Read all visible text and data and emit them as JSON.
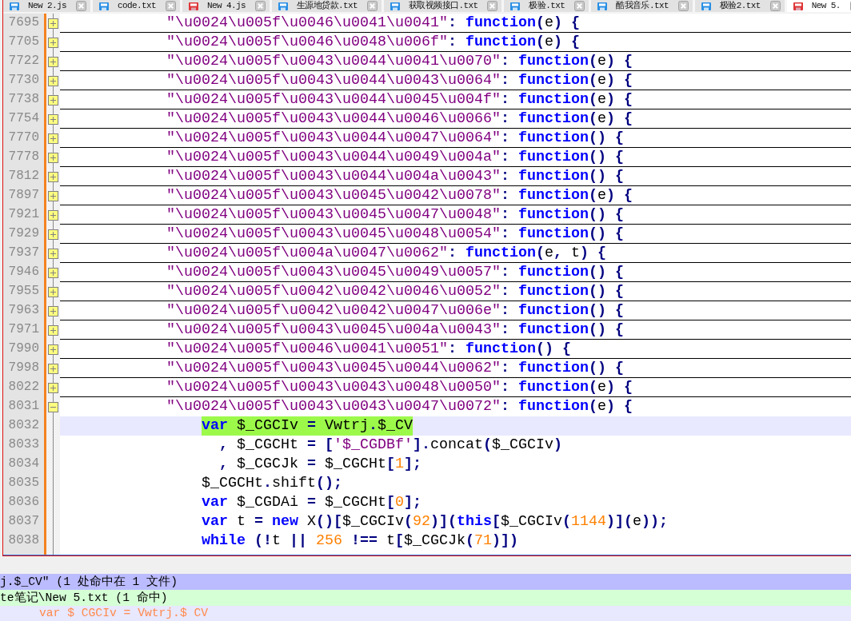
{
  "tabs": [
    {
      "label": "New 2.js",
      "modified": false,
      "selected": false
    },
    {
      "label": "code.txt",
      "modified": false,
      "selected": false
    },
    {
      "label": "New 4.js",
      "modified": true,
      "selected": false
    },
    {
      "label": "生源地贷款.txt",
      "modified": false,
      "selected": false
    },
    {
      "label": "获取视频接口.txt",
      "modified": false,
      "selected": false
    },
    {
      "label": "极验.txt",
      "modified": false,
      "selected": false
    },
    {
      "label": "酷我音乐.txt",
      "modified": false,
      "selected": false
    },
    {
      "label": "极验2.txt",
      "modified": false,
      "selected": false
    },
    {
      "label": "New 5.",
      "modified": true,
      "selected": true
    }
  ],
  "editor": {
    "lines": [
      {
        "number": "7695",
        "expanded": false,
        "current": false,
        "highlighted": false,
        "tokens": [
          {
            "kind": "str",
            "text": "\"\\u0024\\u005f\\u0046\\u0041\\u0041\""
          },
          {
            "kind": "op",
            "text": ": "
          },
          {
            "kind": "kw",
            "text": "function"
          },
          {
            "kind": "op",
            "text": "("
          },
          {
            "kind": "id",
            "text": "e"
          },
          {
            "kind": "op",
            "text": ") {"
          }
        ]
      },
      {
        "number": "7705",
        "expanded": false,
        "current": false,
        "highlighted": false,
        "tokens": [
          {
            "kind": "str",
            "text": "\"\\u0024\\u005f\\u0046\\u0048\\u006f\""
          },
          {
            "kind": "op",
            "text": ": "
          },
          {
            "kind": "kw",
            "text": "function"
          },
          {
            "kind": "op",
            "text": "("
          },
          {
            "kind": "id",
            "text": "e"
          },
          {
            "kind": "op",
            "text": ") {"
          }
        ]
      },
      {
        "number": "7722",
        "expanded": false,
        "current": false,
        "highlighted": false,
        "tokens": [
          {
            "kind": "str",
            "text": "\"\\u0024\\u005f\\u0043\\u0044\\u0041\\u0070\""
          },
          {
            "kind": "op",
            "text": ": "
          },
          {
            "kind": "kw",
            "text": "function"
          },
          {
            "kind": "op",
            "text": "("
          },
          {
            "kind": "id",
            "text": "e"
          },
          {
            "kind": "op",
            "text": ") {"
          }
        ]
      },
      {
        "number": "7730",
        "expanded": false,
        "current": false,
        "highlighted": false,
        "tokens": [
          {
            "kind": "str",
            "text": "\"\\u0024\\u005f\\u0043\\u0044\\u0043\\u0064\""
          },
          {
            "kind": "op",
            "text": ": "
          },
          {
            "kind": "kw",
            "text": "function"
          },
          {
            "kind": "op",
            "text": "("
          },
          {
            "kind": "id",
            "text": "e"
          },
          {
            "kind": "op",
            "text": ") {"
          }
        ]
      },
      {
        "number": "7738",
        "expanded": false,
        "current": false,
        "highlighted": false,
        "tokens": [
          {
            "kind": "str",
            "text": "\"\\u0024\\u005f\\u0043\\u0044\\u0045\\u004f\""
          },
          {
            "kind": "op",
            "text": ": "
          },
          {
            "kind": "kw",
            "text": "function"
          },
          {
            "kind": "op",
            "text": "("
          },
          {
            "kind": "id",
            "text": "e"
          },
          {
            "kind": "op",
            "text": ") {"
          }
        ]
      },
      {
        "number": "7754",
        "expanded": false,
        "current": false,
        "highlighted": false,
        "tokens": [
          {
            "kind": "str",
            "text": "\"\\u0024\\u005f\\u0043\\u0044\\u0046\\u0066\""
          },
          {
            "kind": "op",
            "text": ": "
          },
          {
            "kind": "kw",
            "text": "function"
          },
          {
            "kind": "op",
            "text": "("
          },
          {
            "kind": "id",
            "text": "e"
          },
          {
            "kind": "op",
            "text": ") {"
          }
        ]
      },
      {
        "number": "7770",
        "expanded": false,
        "current": false,
        "highlighted": false,
        "tokens": [
          {
            "kind": "str",
            "text": "\"\\u0024\\u005f\\u0043\\u0044\\u0047\\u0064\""
          },
          {
            "kind": "op",
            "text": ": "
          },
          {
            "kind": "kw",
            "text": "function"
          },
          {
            "kind": "op",
            "text": "() {"
          }
        ]
      },
      {
        "number": "7778",
        "expanded": false,
        "current": false,
        "highlighted": false,
        "tokens": [
          {
            "kind": "str",
            "text": "\"\\u0024\\u005f\\u0043\\u0044\\u0049\\u004a\""
          },
          {
            "kind": "op",
            "text": ": "
          },
          {
            "kind": "kw",
            "text": "function"
          },
          {
            "kind": "op",
            "text": "() {"
          }
        ]
      },
      {
        "number": "7812",
        "expanded": false,
        "current": false,
        "highlighted": false,
        "tokens": [
          {
            "kind": "str",
            "text": "\"\\u0024\\u005f\\u0043\\u0044\\u004a\\u0043\""
          },
          {
            "kind": "op",
            "text": ": "
          },
          {
            "kind": "kw",
            "text": "function"
          },
          {
            "kind": "op",
            "text": "() {"
          }
        ]
      },
      {
        "number": "7897",
        "expanded": false,
        "current": false,
        "highlighted": false,
        "tokens": [
          {
            "kind": "str",
            "text": "\"\\u0024\\u005f\\u0043\\u0045\\u0042\\u0078\""
          },
          {
            "kind": "op",
            "text": ": "
          },
          {
            "kind": "kw",
            "text": "function"
          },
          {
            "kind": "op",
            "text": "("
          },
          {
            "kind": "id",
            "text": "e"
          },
          {
            "kind": "op",
            "text": ") {"
          }
        ]
      },
      {
        "number": "7921",
        "expanded": false,
        "current": false,
        "highlighted": false,
        "tokens": [
          {
            "kind": "str",
            "text": "\"\\u0024\\u005f\\u0043\\u0045\\u0047\\u0048\""
          },
          {
            "kind": "op",
            "text": ": "
          },
          {
            "kind": "kw",
            "text": "function"
          },
          {
            "kind": "op",
            "text": "() {"
          }
        ]
      },
      {
        "number": "7929",
        "expanded": false,
        "current": false,
        "highlighted": false,
        "tokens": [
          {
            "kind": "str",
            "text": "\"\\u0024\\u005f\\u0043\\u0045\\u0048\\u0054\""
          },
          {
            "kind": "op",
            "text": ": "
          },
          {
            "kind": "kw",
            "text": "function"
          },
          {
            "kind": "op",
            "text": "() {"
          }
        ]
      },
      {
        "number": "7937",
        "expanded": false,
        "current": false,
        "highlighted": false,
        "tokens": [
          {
            "kind": "str",
            "text": "\"\\u0024\\u005f\\u004a\\u0047\\u0062\""
          },
          {
            "kind": "op",
            "text": ": "
          },
          {
            "kind": "kw",
            "text": "function"
          },
          {
            "kind": "op",
            "text": "("
          },
          {
            "kind": "id",
            "text": "e"
          },
          {
            "kind": "op",
            "text": ", "
          },
          {
            "kind": "id",
            "text": "t"
          },
          {
            "kind": "op",
            "text": ") {"
          }
        ]
      },
      {
        "number": "7946",
        "expanded": false,
        "current": false,
        "highlighted": false,
        "tokens": [
          {
            "kind": "str",
            "text": "\"\\u0024\\u005f\\u0043\\u0045\\u0049\\u0057\""
          },
          {
            "kind": "op",
            "text": ": "
          },
          {
            "kind": "kw",
            "text": "function"
          },
          {
            "kind": "op",
            "text": "() {"
          }
        ]
      },
      {
        "number": "7955",
        "expanded": false,
        "current": false,
        "highlighted": false,
        "tokens": [
          {
            "kind": "str",
            "text": "\"\\u0024\\u005f\\u0042\\u0042\\u0046\\u0052\""
          },
          {
            "kind": "op",
            "text": ": "
          },
          {
            "kind": "kw",
            "text": "function"
          },
          {
            "kind": "op",
            "text": "() {"
          }
        ]
      },
      {
        "number": "7963",
        "expanded": false,
        "current": false,
        "highlighted": false,
        "tokens": [
          {
            "kind": "str",
            "text": "\"\\u0024\\u005f\\u0042\\u0042\\u0047\\u006e\""
          },
          {
            "kind": "op",
            "text": ": "
          },
          {
            "kind": "kw",
            "text": "function"
          },
          {
            "kind": "op",
            "text": "() {"
          }
        ]
      },
      {
        "number": "7971",
        "expanded": false,
        "current": false,
        "highlighted": false,
        "tokens": [
          {
            "kind": "str",
            "text": "\"\\u0024\\u005f\\u0043\\u0045\\u004a\\u0043\""
          },
          {
            "kind": "op",
            "text": ": "
          },
          {
            "kind": "kw",
            "text": "function"
          },
          {
            "kind": "op",
            "text": "() {"
          }
        ]
      },
      {
        "number": "7990",
        "expanded": false,
        "current": false,
        "highlighted": false,
        "tokens": [
          {
            "kind": "str",
            "text": "\"\\u0024\\u005f\\u0046\\u0041\\u0051\""
          },
          {
            "kind": "op",
            "text": ": "
          },
          {
            "kind": "kw",
            "text": "function"
          },
          {
            "kind": "op",
            "text": "() {"
          }
        ]
      },
      {
        "number": "7998",
        "expanded": false,
        "current": false,
        "highlighted": false,
        "tokens": [
          {
            "kind": "str",
            "text": "\"\\u0024\\u005f\\u0043\\u0045\\u0044\\u0062\""
          },
          {
            "kind": "op",
            "text": ": "
          },
          {
            "kind": "kw",
            "text": "function"
          },
          {
            "kind": "op",
            "text": "() {"
          }
        ]
      },
      {
        "number": "8022",
        "expanded": false,
        "current": false,
        "highlighted": false,
        "tokens": [
          {
            "kind": "str",
            "text": "\"\\u0024\\u005f\\u0043\\u0043\\u0048\\u0050\""
          },
          {
            "kind": "op",
            "text": ": "
          },
          {
            "kind": "kw",
            "text": "function"
          },
          {
            "kind": "op",
            "text": "("
          },
          {
            "kind": "id",
            "text": "e"
          },
          {
            "kind": "op",
            "text": ") {"
          }
        ]
      },
      {
        "number": "8031",
        "expanded": true,
        "current": false,
        "highlighted": false,
        "tokens": [
          {
            "kind": "str",
            "text": "\"\\u0024\\u005f\\u0043\\u0043\\u0047\\u0072\""
          },
          {
            "kind": "op",
            "text": ": "
          },
          {
            "kind": "kw",
            "text": "function"
          },
          {
            "kind": "op",
            "text": "("
          },
          {
            "kind": "id",
            "text": "e"
          },
          {
            "kind": "op",
            "text": ") {"
          }
        ],
        "children": [
          {
            "number": "8032",
            "current": true,
            "highlighted": true,
            "tokens": [
              {
                "kind": "kw",
                "text": "var "
              },
              {
                "kind": "id",
                "text": "$_CGCIv "
              },
              {
                "kind": "op",
                "text": "= "
              },
              {
                "kind": "id",
                "text": "Vwtrj"
              },
              {
                "kind": "op",
                "text": "."
              },
              {
                "kind": "id",
                "text": "$_CV"
              }
            ],
            "children": [
              {
                "number": "8033",
                "current": false,
                "highlighted": false,
                "tokens": [
                  {
                    "kind": "op",
                    "text": ", "
                  },
                  {
                    "kind": "id",
                    "text": "$_CGCHt "
                  },
                  {
                    "kind": "op",
                    "text": "= ["
                  },
                  {
                    "kind": "str",
                    "text": "'$_CGDBf'"
                  },
                  {
                    "kind": "op",
                    "text": "]."
                  },
                  {
                    "kind": "id",
                    "text": "concat"
                  },
                  {
                    "kind": "op",
                    "text": "("
                  },
                  {
                    "kind": "id",
                    "text": "$_CGCIv"
                  },
                  {
                    "kind": "op",
                    "text": ")"
                  }
                ]
              },
              {
                "number": "8034",
                "current": false,
                "highlighted": false,
                "tokens": [
                  {
                    "kind": "op",
                    "text": ", "
                  },
                  {
                    "kind": "id",
                    "text": "$_CGCJk "
                  },
                  {
                    "kind": "op",
                    "text": "= "
                  },
                  {
                    "kind": "id",
                    "text": "$_CGCHt"
                  },
                  {
                    "kind": "op",
                    "text": "["
                  },
                  {
                    "kind": "num",
                    "text": "1"
                  },
                  {
                    "kind": "op",
                    "text": "];"
                  }
                ]
              }
            ]
          },
          {
            "number": "8035",
            "current": false,
            "highlighted": false,
            "tokens": [
              {
                "kind": "id",
                "text": "$_CGCHt"
              },
              {
                "kind": "op",
                "text": "."
              },
              {
                "kind": "id",
                "text": "shift"
              },
              {
                "kind": "op",
                "text": "();"
              }
            ]
          },
          {
            "number": "8036",
            "current": false,
            "highlighted": false,
            "tokens": [
              {
                "kind": "kw",
                "text": "var "
              },
              {
                "kind": "id",
                "text": "$_CGDAi "
              },
              {
                "kind": "op",
                "text": "= "
              },
              {
                "kind": "id",
                "text": "$_CGCHt"
              },
              {
                "kind": "op",
                "text": "["
              },
              {
                "kind": "num",
                "text": "0"
              },
              {
                "kind": "op",
                "text": "];"
              }
            ]
          },
          {
            "number": "8037",
            "current": false,
            "highlighted": false,
            "tokens": [
              {
                "kind": "kw",
                "text": "var "
              },
              {
                "kind": "id",
                "text": "t "
              },
              {
                "kind": "op",
                "text": "= "
              },
              {
                "kind": "kw",
                "text": "new "
              },
              {
                "kind": "id",
                "text": "X"
              },
              {
                "kind": "op",
                "text": "()["
              },
              {
                "kind": "id",
                "text": "$_CGCIv"
              },
              {
                "kind": "op",
                "text": "("
              },
              {
                "kind": "num",
                "text": "92"
              },
              {
                "kind": "op",
                "text": ")]("
              },
              {
                "kind": "kw",
                "text": "this"
              },
              {
                "kind": "op",
                "text": "["
              },
              {
                "kind": "id",
                "text": "$_CGCIv"
              },
              {
                "kind": "op",
                "text": "("
              },
              {
                "kind": "num",
                "text": "1144"
              },
              {
                "kind": "op",
                "text": ")]("
              },
              {
                "kind": "id",
                "text": "e"
              },
              {
                "kind": "op",
                "text": "));"
              }
            ]
          },
          {
            "number": "8038",
            "current": false,
            "highlighted": false,
            "tokens": [
              {
                "kind": "kw",
                "text": "while "
              },
              {
                "kind": "op",
                "text": "(!"
              },
              {
                "kind": "id",
                "text": "t "
              },
              {
                "kind": "op",
                "text": "|| "
              },
              {
                "kind": "num",
                "text": "256 "
              },
              {
                "kind": "op",
                "text": "!== "
              },
              {
                "kind": "id",
                "text": "t"
              },
              {
                "kind": "op",
                "text": "["
              },
              {
                "kind": "id",
                "text": "$_CGCJk"
              },
              {
                "kind": "op",
                "text": "("
              },
              {
                "kind": "num",
                "text": "71"
              },
              {
                "kind": "op",
                "text": ")])"
              }
            ]
          }
        ]
      }
    ]
  },
  "search_results": [
    {
      "kind": "summary",
      "selected": false,
      "text": "j.$_CV\" (1 处命中在 1 文件)"
    },
    {
      "kind": "file",
      "selected": false,
      "text": "te笔记\\New 5.txt (1 命中)"
    },
    {
      "kind": "hit",
      "selected": true,
      "text": "var $ CGCIv = Vwtrj.$ CV"
    }
  ]
}
